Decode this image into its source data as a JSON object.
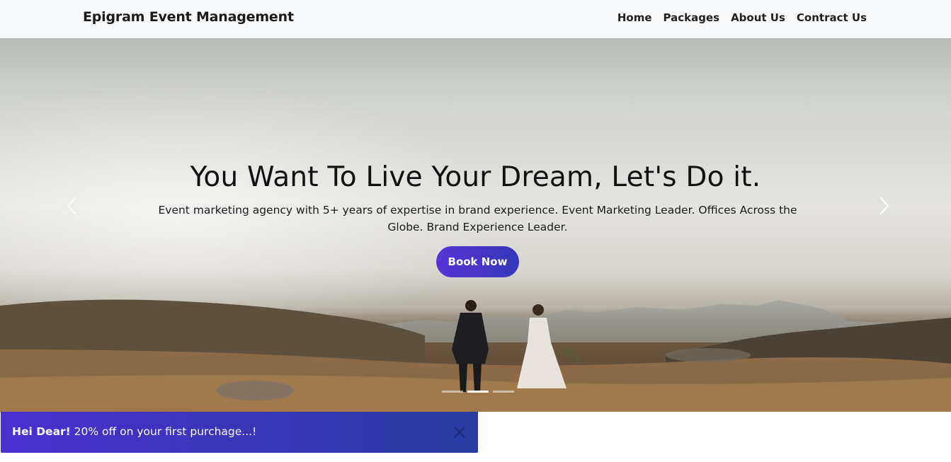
{
  "navbar": {
    "brand": "Epigram Event Management",
    "links": [
      "Home",
      "Packages",
      "About Us",
      "Contract Us"
    ]
  },
  "hero": {
    "title": "You Want To Live Your Dream, Let's Do it.",
    "subtitle": "Event marketing agency with 5+ years of expertise in brand experience. Event Marketing Leader. Offices Across the Globe. Brand Experience Leader.",
    "button": "Book Now",
    "prev_icon": "chevron-left-icon",
    "next_icon": "chevron-right-icon",
    "slides_total": 3,
    "active_slide": 2
  },
  "promo": {
    "bold": "Hei Dear!",
    "text": " 20% off on your first purchage...!",
    "close_icon": "close-icon",
    "accent": "#4a2fd0"
  }
}
